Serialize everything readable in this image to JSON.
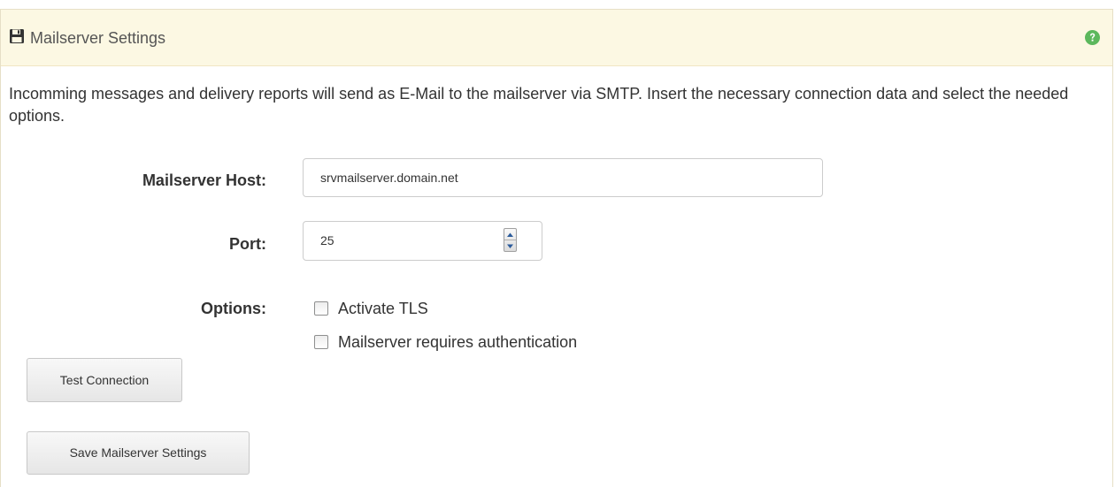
{
  "panel": {
    "title": "Mailserver Settings",
    "title_icon": "floppy-disk-icon",
    "help_icon": "question-circle-icon",
    "description": "Incomming messages and delivery reports will send as E-Mail to the mailserver via SMTP. Insert the necessary connection data and select the needed options."
  },
  "form": {
    "host_label": "Mailserver Host:",
    "host_value": "srvmailserver.domain.net",
    "port_label": "Port:",
    "port_value": "25",
    "options_label": "Options:",
    "options": [
      {
        "label": "Activate TLS",
        "checked": false
      },
      {
        "label": "Mailserver requires authentication",
        "checked": false
      }
    ]
  },
  "buttons": {
    "test_label": "Test Connection",
    "save_label": "Save Mailserver Settings"
  },
  "colors": {
    "heading_bg": "#fcf8e3",
    "help_icon": "#5cb85c",
    "title_icon": "#333333"
  }
}
